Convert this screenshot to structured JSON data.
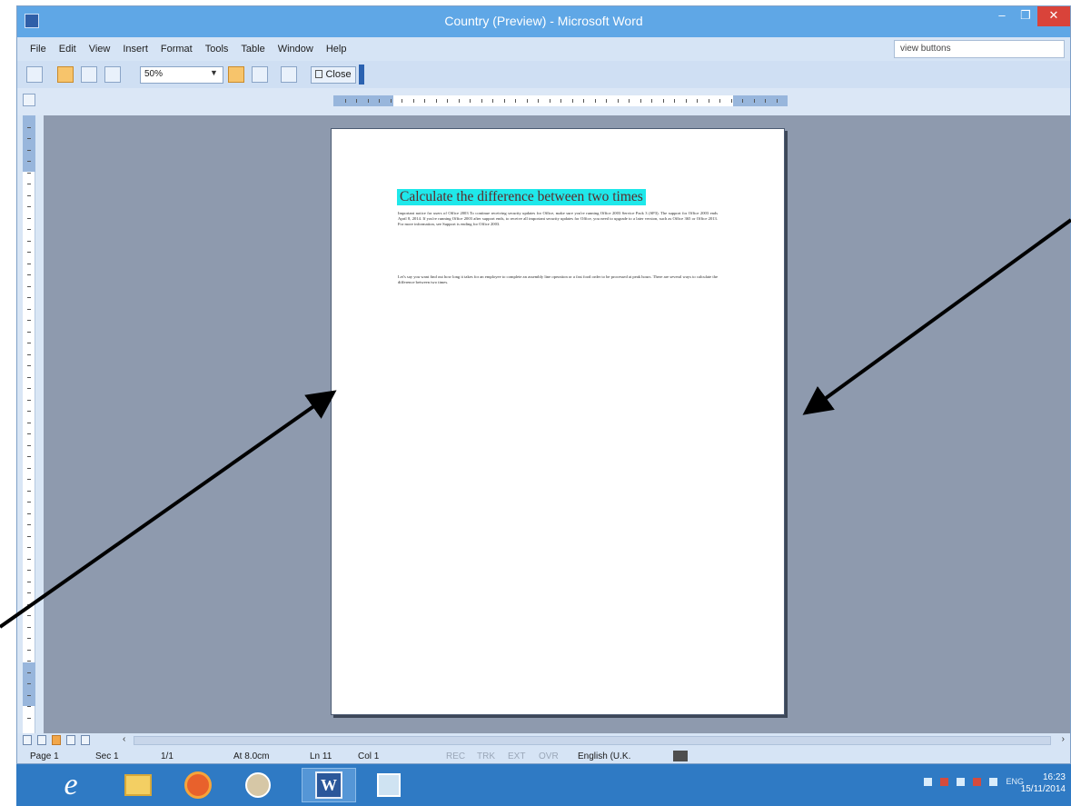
{
  "window": {
    "title": "Country (Preview) - Microsoft Word",
    "minimize_glyph": "–",
    "maximize_glyph": "❐",
    "close_glyph": "✕"
  },
  "menu": {
    "items": [
      "File",
      "Edit",
      "View",
      "Insert",
      "Format",
      "Tools",
      "Table",
      "Window",
      "Help"
    ],
    "help_box_value": "view buttons"
  },
  "toolbar": {
    "zoom_value": "50%",
    "zoom_arrow": "▼",
    "close_preview_label": "Close"
  },
  "document": {
    "heading": "Calculate the difference between two times",
    "paragraph_1": "Important notice for users of Office 2003 To continue receiving security updates for Office, make sure you're running Office 2003 Service Pack 3 (SP3). The support for Office 2003 ends April 8, 2014. If you're running Office 2003 after support ends, to receive all important security updates for Office, you need to upgrade to a later version, such as Office 365 or Office 2013. For more information, see Support is ending for Office 2003.",
    "paragraph_2": "Let's say you want find out how long it takes for an employee to complete an assembly line operation or a fast food order to be processed at peak hours. There are several ways to calculate the difference between two times."
  },
  "scrollbar": {
    "left_arrow": "‹",
    "right_arrow": "›"
  },
  "status": {
    "page": "Page 1",
    "section": "Sec 1",
    "page_of": "1/1",
    "at": "At 8.0cm",
    "line": "Ln 11",
    "col": "Col 1",
    "rec": "REC",
    "trk": "TRK",
    "ext": "EXT",
    "ovr": "OVR",
    "language": "English (U.K."
  },
  "taskbar": {
    "ie_glyph": "e",
    "word_glyph": "W",
    "tray_lang": "ENG",
    "time": "16:23",
    "date": "15/11/2014"
  },
  "colors": {
    "titlebar": "#5fa7e6",
    "workspace": "#8e9aae",
    "heading_highlight": "#1fe8ea",
    "taskbar": "#2f7ac4",
    "close_button": "#d9433a"
  }
}
